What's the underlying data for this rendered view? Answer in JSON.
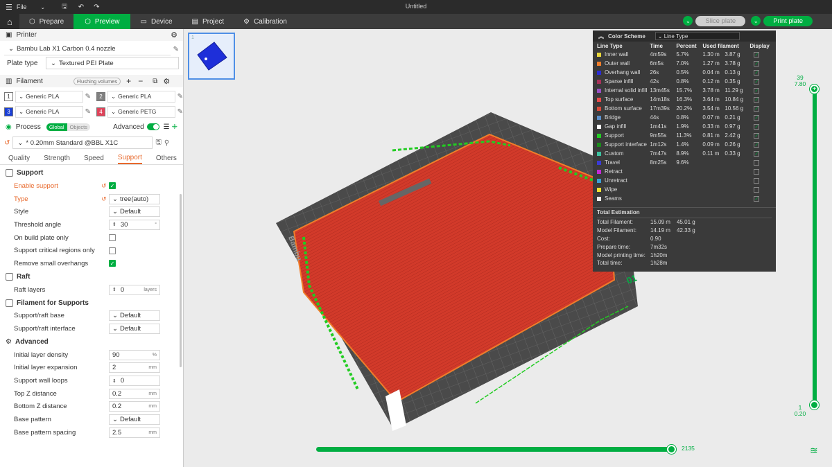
{
  "app": {
    "window_title": "Untitled",
    "file_menu": "File"
  },
  "tabs": [
    {
      "label": "Prepare"
    },
    {
      "label": "Preview"
    },
    {
      "label": "Device"
    },
    {
      "label": "Project"
    },
    {
      "label": "Calibration"
    }
  ],
  "toolbar": {
    "slice_label": "Slice plate",
    "print_label": "Print plate"
  },
  "printer": {
    "section_label": "Printer",
    "name": "Bambu Lab X1 Carbon 0.4 nozzle",
    "plate_type_label": "Plate type",
    "plate_type_value": "Textured PEI Plate"
  },
  "filament": {
    "section_label": "Filament",
    "flushing_label": "Flushing volumes",
    "items": [
      {
        "num": "1",
        "name": "Generic PLA",
        "color": "#ffffff",
        "numcolor": "#333333"
      },
      {
        "num": "2",
        "name": "Generic PLA",
        "color": "#808080",
        "numcolor": "#ffffff"
      },
      {
        "num": "3",
        "name": "Generic PLA",
        "color": "#1a3fd6",
        "numcolor": "#ffffff"
      },
      {
        "num": "4",
        "name": "Generic PETG",
        "color": "#e0435a",
        "numcolor": "#ffffff"
      }
    ]
  },
  "process": {
    "section_label": "Process",
    "global_label": "Global",
    "objects_label": "Objects",
    "advanced_label": "Advanced",
    "preset": "* 0.20mm Standard @BBL X1C",
    "subtabs": [
      "Quality",
      "Strength",
      "Speed",
      "Support",
      "Others"
    ]
  },
  "support": {
    "group_label": "Support",
    "enable_label": "Enable support",
    "type_label": "Type",
    "type_value": "tree(auto)",
    "style_label": "Style",
    "style_value": "Default",
    "threshold_label": "Threshold angle",
    "threshold_value": "30",
    "threshold_unit": "°",
    "build_plate_label": "On build plate only",
    "critical_label": "Support critical regions only",
    "remove_small_label": "Remove small overhangs"
  },
  "raft": {
    "group_label": "Raft",
    "layers_label": "Raft layers",
    "layers_value": "0",
    "layers_unit": "layers"
  },
  "filament_support": {
    "group_label": "Filament for Supports",
    "base_label": "Support/raft base",
    "base_value": "Default",
    "interface_label": "Support/raft interface",
    "interface_value": "Default"
  },
  "advanced": {
    "group_label": "Advanced",
    "density_label": "Initial layer density",
    "density_value": "90",
    "density_unit": "%",
    "expansion_label": "Initial layer expansion",
    "expansion_value": "2",
    "expansion_unit": "mm",
    "wall_loops_label": "Support wall loops",
    "wall_loops_value": "0",
    "top_z_label": "Top Z distance",
    "top_z_value": "0.2",
    "top_z_unit": "mm",
    "bottom_z_label": "Bottom Z distance",
    "bottom_z_value": "0.2",
    "bottom_z_unit": "mm",
    "base_pattern_label": "Base pattern",
    "base_pattern_value": "Default",
    "spacing_label": "Base pattern spacing",
    "spacing_value": "2.5",
    "spacing_unit": "mm"
  },
  "legend": {
    "title": "Color Scheme",
    "scheme": "Line Type",
    "headers": [
      "Line Type",
      "Time",
      "Percent",
      "Used filament",
      "Display"
    ],
    "rows": [
      {
        "name": "Inner wall",
        "time": "4m59s",
        "percent": "5.7%",
        "len": "1.30 m",
        "weight": "3.87 g",
        "color": "#e8d63a",
        "on": true
      },
      {
        "name": "Outer wall",
        "time": "6m5s",
        "percent": "7.0%",
        "len": "1.27 m",
        "weight": "3.78 g",
        "color": "#f07d2a",
        "on": true
      },
      {
        "name": "Overhang wall",
        "time": "26s",
        "percent": "0.5%",
        "len": "0.04 m",
        "weight": "0.13 g",
        "color": "#2b2bd6",
        "on": true
      },
      {
        "name": "Sparse infill",
        "time": "42s",
        "percent": "0.8%",
        "len": "0.12 m",
        "weight": "0.35 g",
        "color": "#a8325a",
        "on": true
      },
      {
        "name": "Internal solid infill",
        "time": "13m45s",
        "percent": "15.7%",
        "len": "3.78 m",
        "weight": "11.29 g",
        "color": "#9a4fc4",
        "on": true
      },
      {
        "name": "Top surface",
        "time": "14m18s",
        "percent": "16.3%",
        "len": "3.64 m",
        "weight": "10.84 g",
        "color": "#e84a4a",
        "on": true
      },
      {
        "name": "Bottom surface",
        "time": "17m39s",
        "percent": "20.2%",
        "len": "3.54 m",
        "weight": "10.56 g",
        "color": "#d94a3a",
        "on": true
      },
      {
        "name": "Bridge",
        "time": "44s",
        "percent": "0.8%",
        "len": "0.07 m",
        "weight": "0.21 g",
        "color": "#5b8fc9",
        "on": true
      },
      {
        "name": "Gap infill",
        "time": "1m41s",
        "percent": "1.9%",
        "len": "0.33 m",
        "weight": "0.97 g",
        "color": "#ffffff",
        "on": true
      },
      {
        "name": "Support",
        "time": "9m55s",
        "percent": "11.3%",
        "len": "0.81 m",
        "weight": "2.42 g",
        "color": "#22cc22",
        "on": true
      },
      {
        "name": "Support interface",
        "time": "1m12s",
        "percent": "1.4%",
        "len": "0.09 m",
        "weight": "0.26 g",
        "color": "#1a8a1a",
        "on": true
      },
      {
        "name": "Custom",
        "time": "7m47s",
        "percent": "8.9%",
        "len": "0.11 m",
        "weight": "0.33 g",
        "color": "#3cc2a0",
        "on": true
      },
      {
        "name": "Travel",
        "time": "8m25s",
        "percent": "9.6%",
        "len": "",
        "weight": "",
        "color": "#3a3ad6",
        "on": false
      },
      {
        "name": "Retract",
        "time": "",
        "percent": "",
        "len": "",
        "weight": "",
        "color": "#c22ad6",
        "on": false
      },
      {
        "name": "Unretract",
        "time": "",
        "percent": "",
        "len": "",
        "weight": "",
        "color": "#3aa0d6",
        "on": false
      },
      {
        "name": "Wipe",
        "time": "",
        "percent": "",
        "len": "",
        "weight": "",
        "color": "#f0e030",
        "on": false
      },
      {
        "name": "Seams",
        "time": "",
        "percent": "",
        "len": "",
        "weight": "",
        "color": "#eeeeee",
        "on": true
      }
    ],
    "total_title": "Total Estimation",
    "totals": [
      {
        "label": "Total Filament:",
        "v1": "15.09 m",
        "v2": "45.01 g"
      },
      {
        "label": "Model Filament:",
        "v1": "14.19 m",
        "v2": "42.33 g"
      },
      {
        "label": "Cost:",
        "v1": "0.90",
        "v2": ""
      },
      {
        "label": "Prepare time:",
        "v1": "7m32s",
        "v2": ""
      },
      {
        "label": "Model printing time:",
        "v1": "1h20m",
        "v2": ""
      },
      {
        "label": "Total time:",
        "v1": "1h28m",
        "v2": ""
      }
    ]
  },
  "layer_slider": {
    "top_layer": "39",
    "top_height": "7.80",
    "bottom_layer": "1",
    "bottom_height": "0.20"
  },
  "move_slider": {
    "value": "2135"
  },
  "plate": {
    "number": "01",
    "thumb_number": "1",
    "brand": "Bambu"
  }
}
